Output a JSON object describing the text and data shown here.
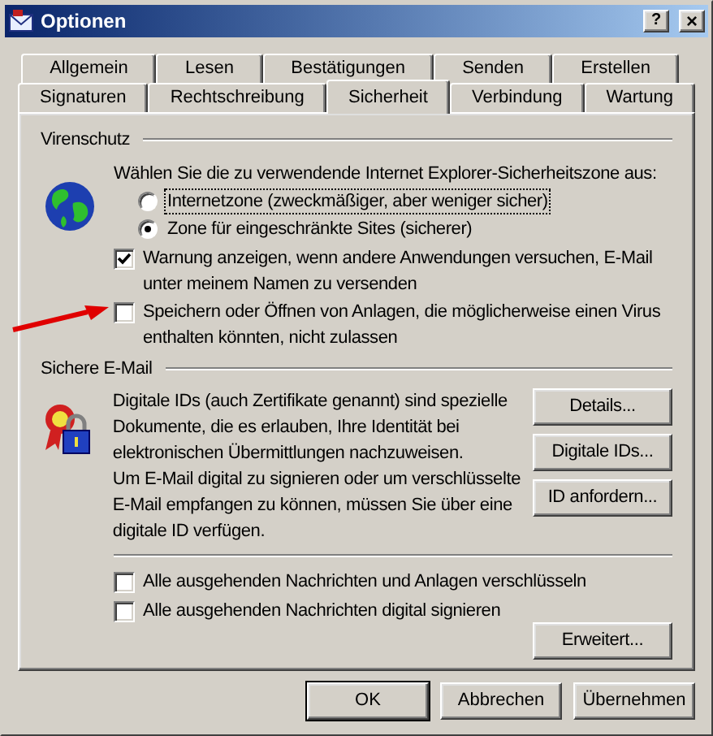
{
  "window": {
    "title": "Optionen",
    "help_button": "?",
    "close_button": "×"
  },
  "tab_rows": [
    {
      "tabs": [
        {
          "label": "Allgemein",
          "selected": false
        },
        {
          "label": "Lesen",
          "selected": false
        },
        {
          "label": "Bestätigungen",
          "selected": false
        },
        {
          "label": "Senden",
          "selected": false
        },
        {
          "label": "Erstellen",
          "selected": false
        }
      ]
    },
    {
      "tabs": [
        {
          "label": "Signaturen",
          "selected": false
        },
        {
          "label": "Rechtschreibung",
          "selected": false
        },
        {
          "label": "Sicherheit",
          "selected": true
        },
        {
          "label": "Verbindung",
          "selected": false
        },
        {
          "label": "Wartung",
          "selected": false
        }
      ]
    }
  ],
  "virus_protection": {
    "title": "Virenschutz",
    "prompt": "Wählen Sie die zu verwendende Internet Explorer-Sicherheitszone aus:",
    "zones": [
      {
        "label": "Internetzone (zweckmäßiger, aber weniger sicher)",
        "selected": false,
        "focused": true
      },
      {
        "label": "Zone für eingeschränkte Sites (sicherer)",
        "selected": true,
        "focused": false
      }
    ],
    "options": [
      {
        "label": "Warnung anzeigen, wenn andere Anwendungen versuchen, E-Mail unter meinem Namen zu versenden",
        "checked": true,
        "annotated": false
      },
      {
        "label": "Speichern oder Öffnen von Anlagen, die möglicherweise einen Virus enthalten könnten, nicht zulassen",
        "checked": false,
        "annotated": true
      }
    ]
  },
  "secure_email": {
    "title": "Sichere E-Mail",
    "paragraphs": [
      "Digitale IDs (auch Zertifikate genannt) sind spezielle Dokumente, die es erlauben, Ihre Identität bei elektronischen Übermittlungen nachzuweisen.",
      "Um E-Mail digital zu signieren oder um verschlüsselte E-Mail empfangen zu können, müssen Sie über eine digitale ID verfügen."
    ],
    "buttons": [
      "Details...",
      "Digitale IDs...",
      "ID anfordern..."
    ],
    "options": [
      {
        "label": "Alle ausgehenden Nachrichten und Anlagen verschlüsseln",
        "checked": false
      },
      {
        "label": "Alle ausgehenden Nachrichten digital signieren",
        "checked": false
      }
    ],
    "advanced_button": "Erweitert..."
  },
  "footer_buttons": [
    {
      "label": "OK",
      "default": true
    },
    {
      "label": "Abbrechen",
      "default": false
    },
    {
      "label": "Übernehmen",
      "default": false
    }
  ]
}
